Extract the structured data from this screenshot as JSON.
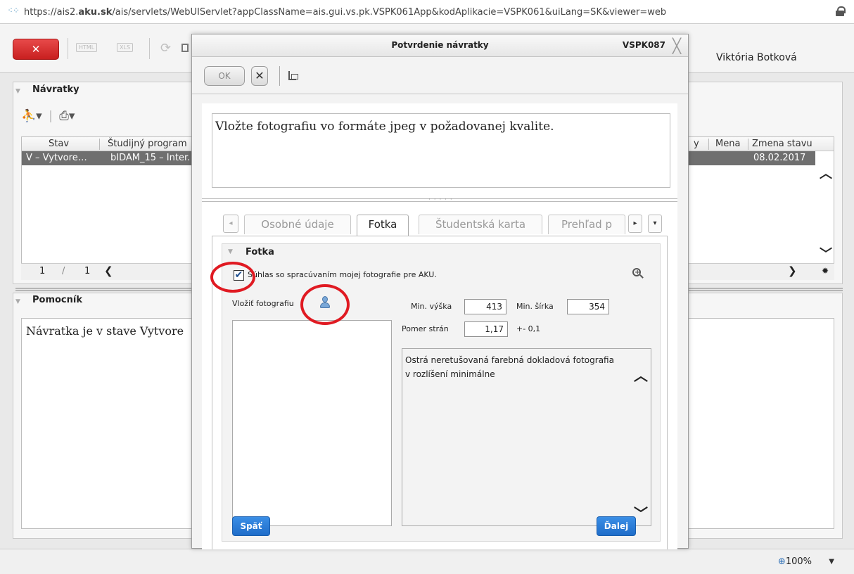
{
  "browser": {
    "url_prefix": "https://ais2.",
    "url_domain": "aku.sk",
    "url_rest": "/ais/servlets/WebUIServlet?appClassName=ais.gui.vs.pk.VSPK061App&kodAplikacie=VSPK061&uiLang=SK&viewer=web"
  },
  "app_toolbar": {
    "close_label": "✕",
    "html_label": "HTML",
    "xls_label": "XLS",
    "user_name": "Viktória Botková"
  },
  "navratky": {
    "title": "Návratky",
    "columns": [
      "Stav",
      "Študijný program",
      "y",
      "Mena",
      "Zmena stavu"
    ],
    "row": {
      "stav": "V – Vytvore…",
      "program": "bIDAM_15 – Inter.",
      "zmena": "08.02.2017"
    },
    "pager": {
      "page": "1",
      "sep": "/",
      "total": "1"
    }
  },
  "pomocnik": {
    "title": "Pomocník",
    "text": "Návratka je v stave Vytvore"
  },
  "modal": {
    "title": "Potvrdenie návratky",
    "code": "VSPK087",
    "ok_label": "OK",
    "cancel_label": "✕",
    "message": "Vložte fotografiu vo formáte jpeg v požadovanej kvalite.",
    "tabs": [
      "Osobné údaje",
      "Fotka",
      "Študentská karta",
      "Prehľad p"
    ],
    "active_tab": "Fotka",
    "fotka": {
      "title": "Fotka",
      "consent_label": "Súhlas so spracúvaním mojej fotografie pre AKU.",
      "consent_checked": true,
      "insert_label": "Vložiť fotografiu",
      "min_height_label": "Min. výška",
      "min_height_value": "413",
      "min_width_label": "Min. šírka",
      "min_width_value": "354",
      "ratio_label": "Pomer strán",
      "ratio_value": "1,17",
      "ratio_tolerance": "+- 0,1",
      "description": "Ostrá neretušovaná farebná dokladová fotografia v rozlíšení minimálne",
      "back_label": "Späť",
      "next_label": "Ďalej"
    }
  },
  "statusbar": {
    "zoom": "100%"
  },
  "colors": {
    "annotation_red": "#e01a22",
    "primary_blue": "#1f6dc9",
    "close_red": "#d22b2b"
  }
}
